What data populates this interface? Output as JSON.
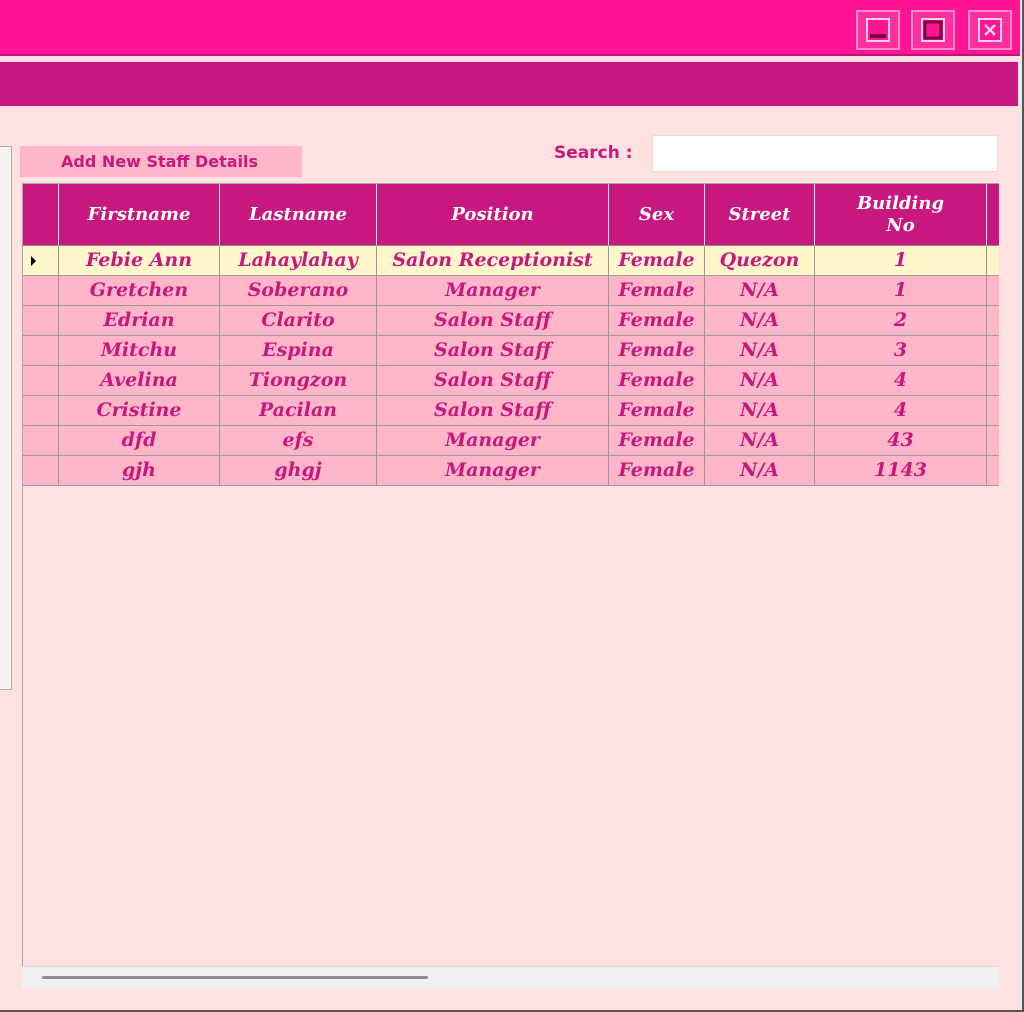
{
  "window": {
    "accent": "#ff1493",
    "menu_color": "#c8177e",
    "controls": [
      "minimize-icon",
      "maximize-icon",
      "close-icon"
    ]
  },
  "toolbar": {
    "add_label": "Add New Staff Details",
    "search_label": "Search :",
    "search_value": ""
  },
  "table": {
    "columns": [
      "Firstname",
      "Lastname",
      "Position",
      "Sex",
      "Street",
      "Building\nNo"
    ],
    "rows": [
      [
        "Febie Ann",
        "Lahaylahay",
        "Salon Receptionist",
        "Female",
        "Quezon",
        "1"
      ],
      [
        "Gretchen",
        "Soberano",
        "Manager",
        "Female",
        "N/A",
        "1"
      ],
      [
        "Edrian",
        "Clarito",
        "Salon Staff",
        "Female",
        "N/A",
        "2"
      ],
      [
        "Mitchu",
        "Espina",
        "Salon Staff",
        "Female",
        "N/A",
        "3"
      ],
      [
        "Avelina",
        "Tiongzon",
        "Salon Staff",
        "Female",
        "N/A",
        "4"
      ],
      [
        "Cristine",
        "Pacilan",
        "Salon Staff",
        "Female",
        "N/A",
        "4"
      ],
      [
        "dfd",
        "efs",
        "Manager",
        "Female",
        "N/A",
        "43"
      ],
      [
        "gjh",
        "ghgj",
        "Manager",
        "Female",
        "N/A",
        "1143"
      ]
    ],
    "selected_row": 0
  }
}
